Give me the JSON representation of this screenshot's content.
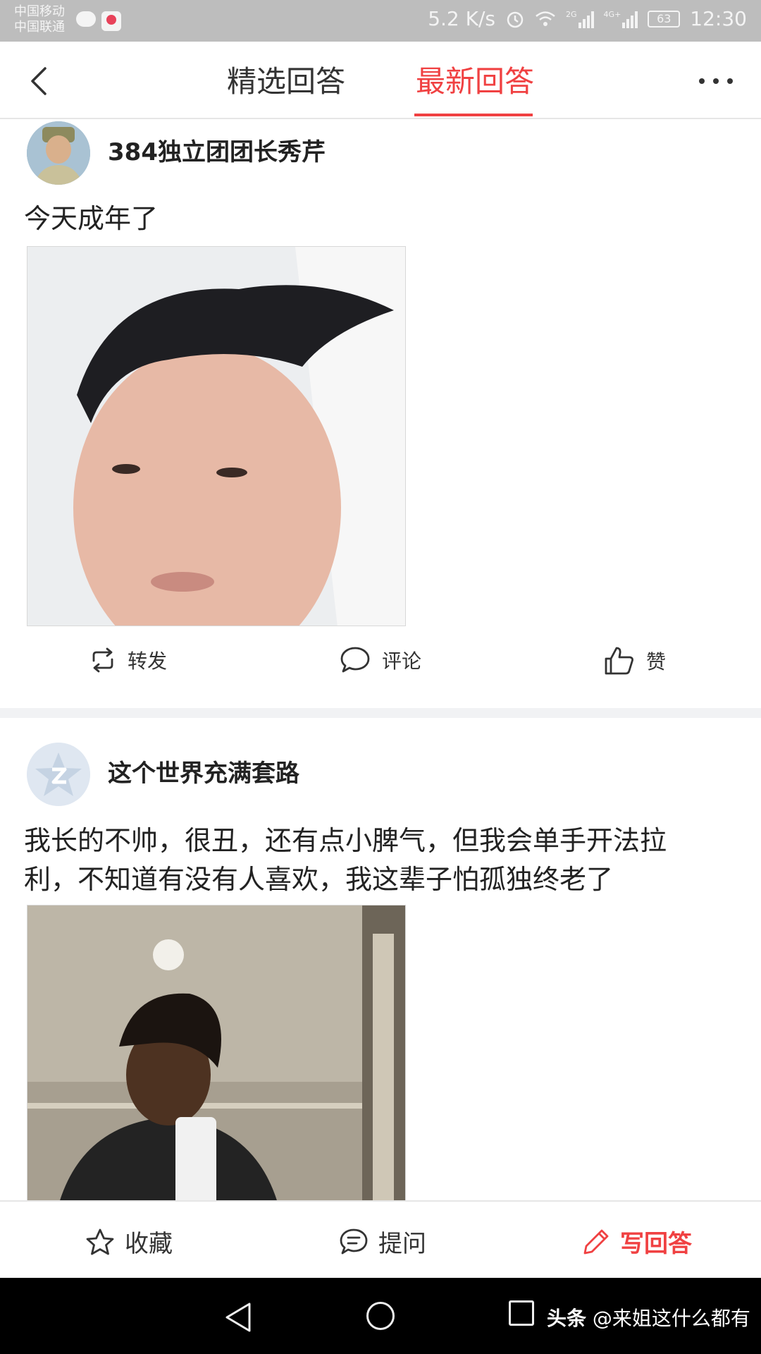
{
  "status_bar": {
    "carrier_1": "中国移动",
    "carrier_2": "中国联通",
    "net_speed": "5.2 K/s",
    "net_2g": "2G",
    "net_4g": "4G+",
    "battery": "63",
    "time": "12:30",
    "icons": [
      "chat-icon",
      "app-badge-icon",
      "alarm-icon",
      "wifi-icon",
      "signal-icon",
      "signal-icon",
      "battery-icon"
    ]
  },
  "nav": {
    "back_icon": "back-arrow-icon",
    "tabs": [
      {
        "label": "精选回答",
        "active": false
      },
      {
        "label": "最新回答",
        "active": true
      }
    ],
    "more_icon": "more-dots-icon",
    "accent_color": "#f04142"
  },
  "answers": [
    {
      "username": "384独立团团长秀芹",
      "avatar": "portrait-avatar",
      "text": "今天成年了",
      "actions": {
        "repost": "转发",
        "comment": "评论",
        "like": "赞"
      }
    },
    {
      "username": "这个世界充满套路",
      "avatar": "default-avatar",
      "text_line1": "我长的不帅，很丑，还有点小脾气，但我会单手开法拉",
      "text_line2": "利，不知道有没有人喜欢，我这辈子怕孤独终老了"
    }
  ],
  "toolbar": {
    "favorite": "收藏",
    "ask": "提问",
    "write": "写回答"
  },
  "watermark": {
    "brand": "头条",
    "handle": "@来姐这什么都有"
  }
}
